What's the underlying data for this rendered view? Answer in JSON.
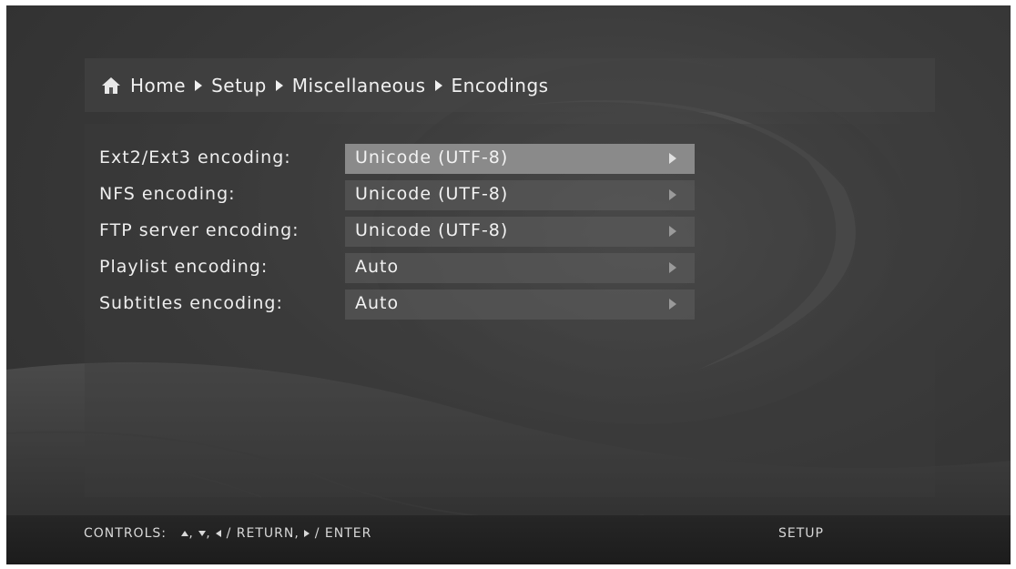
{
  "breadcrumb": {
    "icon": "home-icon",
    "items": [
      "Home",
      "Setup",
      "Miscellaneous",
      "Encodings"
    ]
  },
  "settings": [
    {
      "label": "Ext2/Ext3 encoding:",
      "value": "Unicode (UTF-8)",
      "selected": true
    },
    {
      "label": "NFS encoding:",
      "value": "Unicode (UTF-8)",
      "selected": false
    },
    {
      "label": "FTP server encoding:",
      "value": "Unicode (UTF-8)",
      "selected": false
    },
    {
      "label": "Playlist encoding:",
      "value": "Auto",
      "selected": false
    },
    {
      "label": "Subtitles encoding:",
      "value": "Auto",
      "selected": false
    }
  ],
  "footer": {
    "controls_prefix": "CONTROLS:",
    "return_label": "/ RETURN,",
    "enter_label": "/ ENTER",
    "section": "SETUP"
  },
  "colors": {
    "background": "#3a3a3a",
    "selected_row": "#8a8a8a",
    "text": "#f0f0f0"
  }
}
